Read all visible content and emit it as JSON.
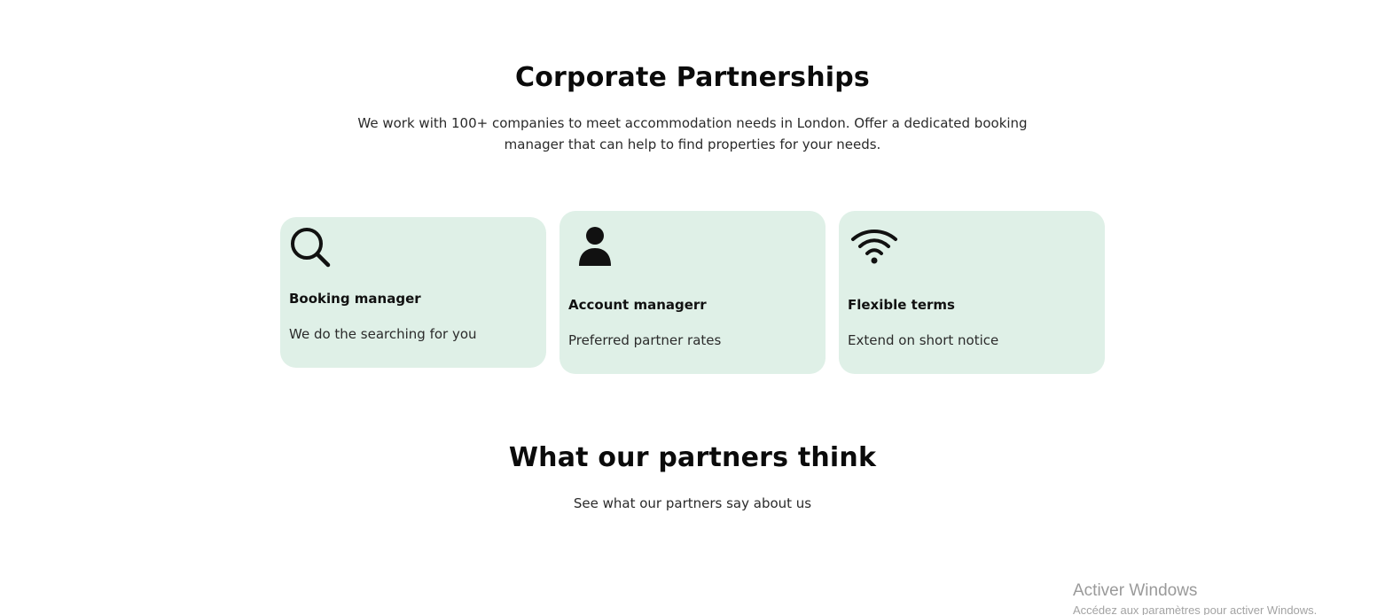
{
  "corporate": {
    "title": "Corporate Partnerships",
    "description_line1": "We work with 100+ companies to meet accommodation needs in London. Offer a dedicated booking",
    "description_line2": "manager that can help to find properties for your needs."
  },
  "cards": [
    {
      "icon": "search-icon",
      "title": "Booking manager",
      "text": "We do the searching for you"
    },
    {
      "icon": "person-icon",
      "title": "Account managerr",
      "text": "Preferred partner rates"
    },
    {
      "icon": "wifi-icon",
      "title": "Flexible terms",
      "text": "Extend on short notice"
    }
  ],
  "partners": {
    "title": "What our partners think",
    "description": "See what our partners say about us"
  },
  "watermark": {
    "title": "Activer Windows",
    "subtitle": "Accédez aux paramètres pour activer Windows."
  },
  "colors": {
    "card_background": "#dff0e7",
    "heading": "#0b0b0b",
    "watermark": "#9a9a9a"
  }
}
